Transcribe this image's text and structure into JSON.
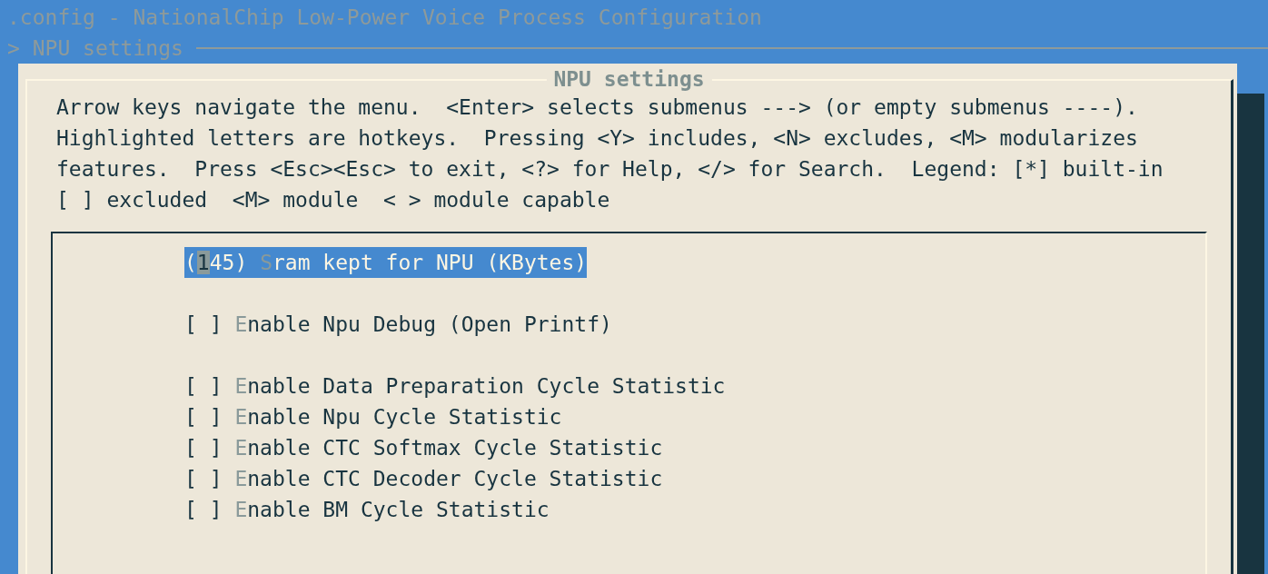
{
  "window": {
    "title": ".config - NationalChip Low-Power Voice Process Configuration"
  },
  "breadcrumb": "> NPU settings",
  "dialog": {
    "title": "NPU settings",
    "help": [
      "Arrow keys navigate the menu.  <Enter> selects submenus ---> (or empty submenus ----).",
      "Highlighted letters are hotkeys.  Pressing <Y> includes, <N> excludes, <M> modularizes",
      "features.  Press <Esc><Esc> to exit, <?> for Help, </> for Search.  Legend: [*] built-in",
      "[ ] excluded  <M> module  < > module capable"
    ],
    "menu_groups": [
      [
        {
          "kind": "value",
          "value": "(145)",
          "prompt": "Sram kept for NPU (KBytes)",
          "selected": true
        }
      ],
      [
        {
          "kind": "bool",
          "box": "[ ]",
          "checked": false,
          "prompt": "Enable Npu Debug (Open Printf)",
          "selected": false
        }
      ],
      [
        {
          "kind": "bool",
          "box": "[ ]",
          "checked": false,
          "prompt": "Enable Data Preparation Cycle Statistic",
          "selected": false
        },
        {
          "kind": "bool",
          "box": "[ ]",
          "checked": false,
          "prompt": "Enable Npu Cycle Statistic",
          "selected": false
        },
        {
          "kind": "bool",
          "box": "[ ]",
          "checked": false,
          "prompt": "Enable CTC Softmax Cycle Statistic",
          "selected": false
        },
        {
          "kind": "bool",
          "box": "[ ]",
          "checked": false,
          "prompt": "Enable CTC Decoder Cycle Statistic",
          "selected": false
        },
        {
          "kind": "bool",
          "box": "[ ]",
          "checked": false,
          "prompt": "Enable BM Cycle Statistic",
          "selected": false
        }
      ]
    ]
  }
}
